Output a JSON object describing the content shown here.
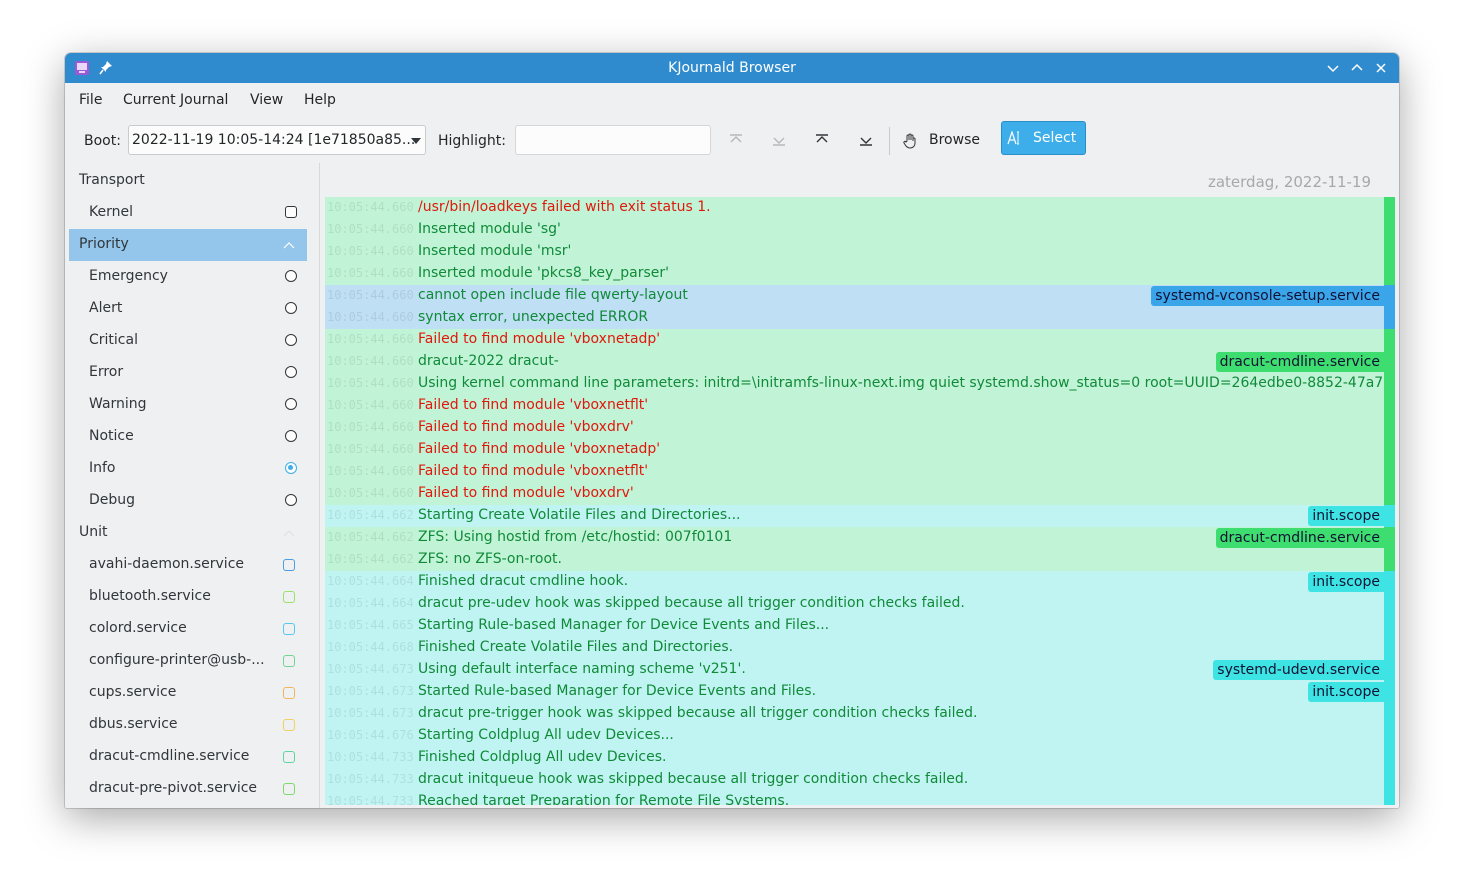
{
  "window": {
    "title": "KJournald Browser"
  },
  "menu": [
    "File",
    "Current Journal",
    "View",
    "Help"
  ],
  "toolbar": {
    "boot_label": "Boot:",
    "boot_value": "2022-11-19 10:05-14:24 [1e71850a85...",
    "highlight_label": "Highlight:",
    "highlight_value": "",
    "browse_label": "Browse",
    "select_label": "Select"
  },
  "sidebar": {
    "transport": {
      "label": "Transport",
      "items": [
        "Kernel"
      ]
    },
    "priority": {
      "label": "Priority",
      "items": [
        "Emergency",
        "Alert",
        "Critical",
        "Error",
        "Warning",
        "Notice",
        "Info",
        "Debug"
      ],
      "selected": "Info"
    },
    "unit": {
      "label": "Unit",
      "items": [
        {
          "name": "avahi-daemon.service",
          "color": "#4a9de6"
        },
        {
          "name": "bluetooth.service",
          "color": "#9be06a"
        },
        {
          "name": "colord.service",
          "color": "#55c8f0"
        },
        {
          "name": "configure-printer@usb-...",
          "color": "#6fd68f"
        },
        {
          "name": "cups.service",
          "color": "#f4b55a"
        },
        {
          "name": "dbus.service",
          "color": "#f0d060"
        },
        {
          "name": "dracut-cmdline.service",
          "color": "#5ed6a0"
        },
        {
          "name": "dracut-pre-pivot.service",
          "color": "#7ed86a"
        }
      ]
    }
  },
  "main": {
    "date": "zaterdag, 2022-11-19",
    "colors": {
      "green": "#c1f4d7",
      "blue": "#bfdff5",
      "cyan": "#c0f4f3",
      "red_text": "#e0180c",
      "green_text": "#108a38"
    },
    "log": [
      {
        "ts": "10:05:44.660",
        "msg": "/usr/bin/loadkeys failed with exit status 1.",
        "bg": "green",
        "color": "red",
        "tag": "",
        "bar": "#3ddd6f"
      },
      {
        "ts": "10:05:44.660",
        "msg": "Inserted module 'sg'",
        "bg": "green",
        "color": "green",
        "tag": "",
        "bar": "#3ddd6f"
      },
      {
        "ts": "10:05:44.660",
        "msg": "Inserted module 'msr'",
        "bg": "green",
        "color": "green",
        "tag": "",
        "bar": "#3ddd6f"
      },
      {
        "ts": "10:05:44.660",
        "msg": "Inserted module 'pkcs8_key_parser'",
        "bg": "green",
        "color": "green",
        "tag": "",
        "bar": "#3ddd6f"
      },
      {
        "ts": "10:05:44.660",
        "msg": "cannot open include file qwerty-layout",
        "bg": "blue",
        "color": "green",
        "tag": "systemd-vconsole-setup.service",
        "tagcolor": "#3ba5ea",
        "bar": "#3ba5ea"
      },
      {
        "ts": "10:05:44.660",
        "msg": "syntax error, unexpected ERROR",
        "bg": "blue",
        "color": "green",
        "tag": "",
        "bar": "#3ba5ea"
      },
      {
        "ts": "10:05:44.660",
        "msg": "Failed to find module 'vboxnetadp'",
        "bg": "green",
        "color": "red",
        "tag": "",
        "bar": "#3ddd6f"
      },
      {
        "ts": "10:05:44.660",
        "msg": "dracut-2022 dracut-",
        "bg": "green",
        "color": "green",
        "tag": "dracut-cmdline.service",
        "tagcolor": "#3ddd6f",
        "bar": "#3ddd6f"
      },
      {
        "ts": "10:05:44.660",
        "msg": "Using kernel command line parameters:    initrd=\\initramfs-linux-next.img quiet systemd.show_status=0 root=UUID=264edbe0-8852-47a7",
        "bg": "green",
        "color": "green",
        "tag": "",
        "bar": "#3ddd6f"
      },
      {
        "ts": "10:05:44.660",
        "msg": "Failed to find module 'vboxnetflt'",
        "bg": "green",
        "color": "red",
        "tag": "",
        "bar": "#3ddd6f"
      },
      {
        "ts": "10:05:44.660",
        "msg": "Failed to find module 'vboxdrv'",
        "bg": "green",
        "color": "red",
        "tag": "",
        "bar": "#3ddd6f"
      },
      {
        "ts": "10:05:44.660",
        "msg": "Failed to find module 'vboxnetadp'",
        "bg": "green",
        "color": "red",
        "tag": "",
        "bar": "#3ddd6f"
      },
      {
        "ts": "10:05:44.660",
        "msg": "Failed to find module 'vboxnetflt'",
        "bg": "green",
        "color": "red",
        "tag": "",
        "bar": "#3ddd6f"
      },
      {
        "ts": "10:05:44.660",
        "msg": "Failed to find module 'vboxdrv'",
        "bg": "green",
        "color": "red",
        "tag": "",
        "bar": "#3ddd6f"
      },
      {
        "ts": "10:05:44.662",
        "msg": "Starting Create Volatile Files and Directories...",
        "bg": "cyan",
        "color": "green",
        "tag": "init.scope",
        "tagcolor": "#3ee4e4",
        "bar": "#3ee4e4"
      },
      {
        "ts": "10:05:44.662",
        "msg": "ZFS: Using hostid from /etc/hostid: 007f0101",
        "bg": "green",
        "color": "green",
        "tag": "dracut-cmdline.service",
        "tagcolor": "#3ddd6f",
        "bar": "#3ddd6f"
      },
      {
        "ts": "10:05:44.662",
        "msg": "ZFS: no ZFS-on-root.",
        "bg": "green",
        "color": "green",
        "tag": "",
        "bar": "#3ddd6f"
      },
      {
        "ts": "10:05:44.664",
        "msg": "Finished dracut cmdline hook.",
        "bg": "cyan",
        "color": "green",
        "tag": "init.scope",
        "tagcolor": "#3ee4e4",
        "bar": "#3ee4e4"
      },
      {
        "ts": "10:05:44.664",
        "msg": "dracut pre-udev hook was skipped because all trigger condition checks failed.",
        "bg": "cyan",
        "color": "green",
        "tag": "",
        "bar": "#3ee4e4"
      },
      {
        "ts": "10:05:44.665",
        "msg": "Starting Rule-based Manager for Device Events and Files...",
        "bg": "cyan",
        "color": "green",
        "tag": "",
        "bar": "#3ee4e4"
      },
      {
        "ts": "10:05:44.668",
        "msg": "Finished Create Volatile Files and Directories.",
        "bg": "cyan",
        "color": "green",
        "tag": "",
        "bar": "#3ee4e4"
      },
      {
        "ts": "10:05:44.673",
        "msg": "Using default interface naming scheme 'v251'.",
        "bg": "cyan",
        "color": "green",
        "tag": "systemd-udevd.service",
        "tagcolor": "#3ee4e4",
        "bar": "#3ee4e4"
      },
      {
        "ts": "10:05:44.673",
        "msg": "Started Rule-based Manager for Device Events and Files.",
        "bg": "cyan",
        "color": "green",
        "tag": "init.scope",
        "tagcolor": "#3ee4e4",
        "bar": "#3ee4e4"
      },
      {
        "ts": "10:05:44.673",
        "msg": "dracut pre-trigger hook was skipped because all trigger condition checks failed.",
        "bg": "cyan",
        "color": "green",
        "tag": "",
        "bar": "#3ee4e4"
      },
      {
        "ts": "10:05:44.676",
        "msg": "Starting Coldplug All udev Devices...",
        "bg": "cyan",
        "color": "green",
        "tag": "",
        "bar": "#3ee4e4"
      },
      {
        "ts": "10:05:44.733",
        "msg": "Finished Coldplug All udev Devices.",
        "bg": "cyan",
        "color": "green",
        "tag": "",
        "bar": "#3ee4e4"
      },
      {
        "ts": "10:05:44.733",
        "msg": "dracut initqueue hook was skipped because all trigger condition checks failed.",
        "bg": "cyan",
        "color": "green",
        "tag": "",
        "bar": "#3ee4e4"
      },
      {
        "ts": "10:05:44.733",
        "msg": "Reached target Preparation for Remote File Systems.",
        "bg": "cyan",
        "color": "green",
        "tag": "",
        "bar": "#3ee4e4"
      }
    ]
  }
}
